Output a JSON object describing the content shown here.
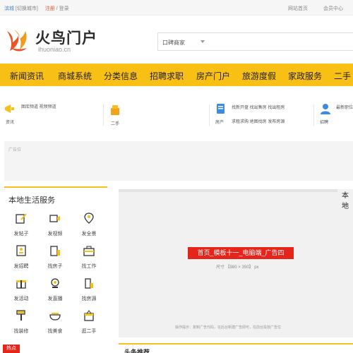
{
  "topbar": {
    "city": "滨城",
    "switch_city": "[切换城市]",
    "register": "注册",
    "sep": "/",
    "login": "登录",
    "homepage": "网站首页",
    "member": "会员中心"
  },
  "logo": {
    "name": "火鸟门户",
    "domain": "ihuoniao.cn"
  },
  "search": {
    "scope": "口碑商家"
  },
  "nav": {
    "items": [
      "新闻资讯",
      "商城系统",
      "分类信息",
      "招聘求职",
      "房产门户",
      "旅游度假",
      "家政服务",
      "二手"
    ]
  },
  "quick": {
    "news_label": "资讯",
    "news_links": "图库频道  视频频道",
    "second_hand": "二手",
    "house_label": "房产",
    "house_links_1": "找新开盘  找出售房  找出租房",
    "house_links_2": "求租求购  地图找房  发布房源",
    "job_label": "招聘",
    "job_links": "最新职位"
  },
  "ad": {
    "label": "广告位"
  },
  "life": {
    "title": "本地生活服务",
    "cells": [
      "发帖子",
      "发视频",
      "发全景",
      "发招聘",
      "找房子",
      "找工作",
      "发活动",
      "发直播",
      "找房源",
      "找装修",
      "找美食",
      "逛二手"
    ]
  },
  "bigad": {
    "title": "首页_模板十一_电脑端_广告四",
    "size": "尺寸 【980 × 350】 px",
    "tip": "操作提示：复制广告代码，在后台新建广告即可，在前台投放广告位"
  },
  "corner_text": "本地",
  "bottom": {
    "hot": "热点",
    "title": "头条推荐"
  },
  "colors": {
    "accent": "#f8bf14",
    "red": "#e5251b",
    "blue": "#4a8ad6"
  }
}
